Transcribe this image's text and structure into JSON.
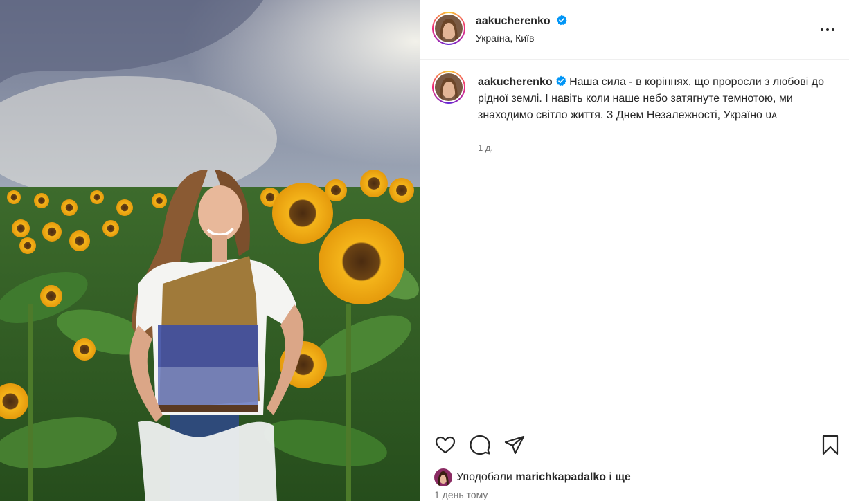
{
  "post": {
    "username": "aakucherenko",
    "location": "Україна, Київ",
    "caption_username": "aakucherenko",
    "caption_text": "Наша сила - в коріннях, що проросли з любові до рідної землі. І навіть коли наше небо затягнуте темнотою, ми знаходимо світло життя. З Днем Незалежності, Україно ᴜᴀ",
    "caption_time": "1 д.",
    "likes_prefix": "Уподобали",
    "likes_user": "marichkapadalko",
    "likes_suffix": "і ще",
    "posted_time": "1 день тому"
  },
  "icons": {
    "verified": "verified-badge-icon",
    "more": "more-options-icon",
    "like": "heart-icon",
    "comment": "comment-icon",
    "share": "share-icon",
    "save": "bookmark-icon"
  },
  "colors": {
    "verified": "#0095f6",
    "text": "#262626",
    "secondary": "#737373",
    "divider": "#efefef"
  }
}
